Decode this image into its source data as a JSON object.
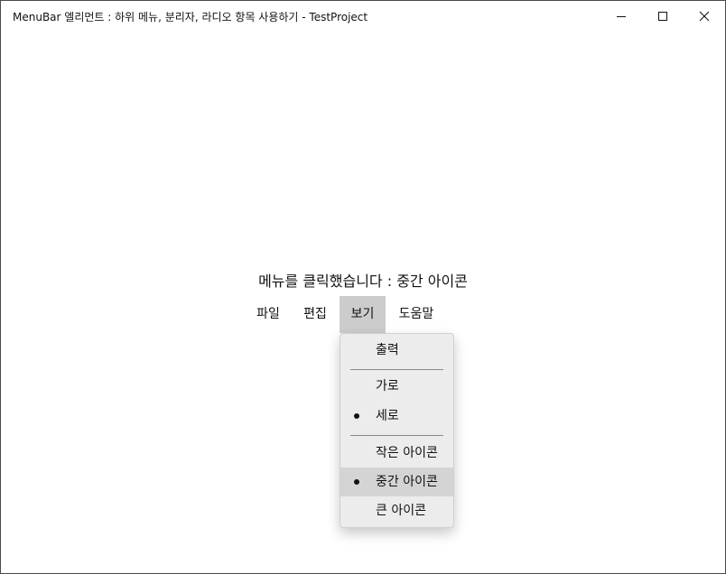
{
  "window": {
    "title": "MenuBar 엘리먼트 : 하위 메뉴, 분리자, 라디오 항목 사용하기 - TestProject"
  },
  "status_text": "메뉴를 클릭했습니다 : 중간 아이콘",
  "menubar": {
    "items": [
      {
        "label": "파일"
      },
      {
        "label": "편집"
      },
      {
        "label": "보기"
      },
      {
        "label": "도움말"
      }
    ]
  },
  "view_menu": {
    "items": [
      {
        "label": "출력"
      },
      {
        "label": "가로"
      },
      {
        "label": "세로",
        "checked": true
      },
      {
        "label": "작은 아이콘"
      },
      {
        "label": "중간 아이콘",
        "checked": true
      },
      {
        "label": "큰 아이콘"
      }
    ]
  }
}
